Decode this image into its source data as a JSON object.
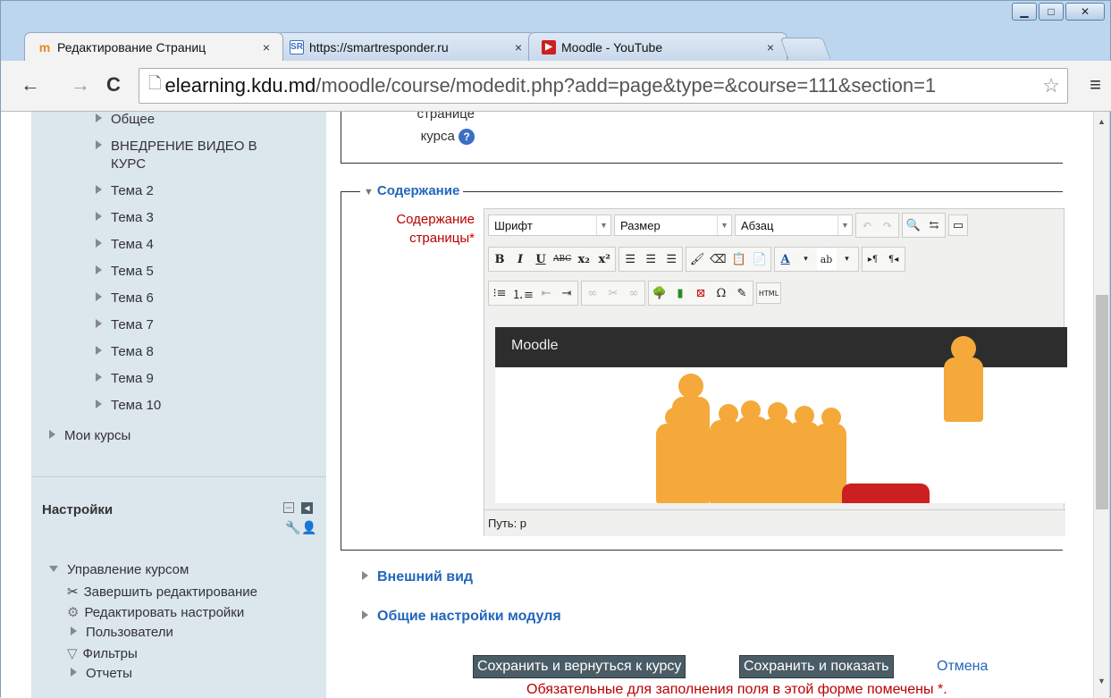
{
  "window": {
    "minimize_label": "▁",
    "maximize_label": "□",
    "close_label": "✕"
  },
  "tabs": [
    {
      "favicon": "moodle-favicon",
      "favicon_text": "m",
      "title": "Редактирование Страниц",
      "close": "×"
    },
    {
      "favicon": "sr-favicon",
      "favicon_text": "SR",
      "title": "https://smartresponder.ru",
      "close": "×"
    },
    {
      "favicon": "youtube-favicon",
      "favicon_text": "▶",
      "title": "Moodle - YouTube",
      "close": "×"
    }
  ],
  "toolbar": {
    "back": "←",
    "forward": "→",
    "reload": "C",
    "url_host": "elearning.kdu.md",
    "url_path": "/moodle/course/modedit.php?add=page&type=&course=111&section=1",
    "star": "☆",
    "menu": "≡"
  },
  "sidebar": {
    "items": [
      {
        "label": "Общее"
      },
      {
        "label": "ВНЕДРЕНИЕ ВИДЕО В"
      },
      {
        "label": "КУРС"
      },
      {
        "label": "Тема 2"
      },
      {
        "label": "Тема 3"
      },
      {
        "label": "Тема 4"
      },
      {
        "label": "Тема 5"
      },
      {
        "label": "Тема 6"
      },
      {
        "label": "Тема 7"
      },
      {
        "label": "Тема 8"
      },
      {
        "label": "Тема 9"
      },
      {
        "label": "Тема 10"
      }
    ],
    "my_courses": "Мои курсы",
    "settings_title": "Настройки",
    "course_admin": "Управление курсом",
    "admin_items": [
      {
        "label": "Завершить редактирование"
      },
      {
        "label": "Редактировать настройки"
      },
      {
        "label": "Пользователи"
      },
      {
        "label": "Фильтры"
      },
      {
        "label": "Отчеты"
      }
    ]
  },
  "main": {
    "top_label_line1": "странице",
    "top_label_line2": "курса",
    "help": "?",
    "content_legend": "Содержание",
    "content_label_line1": "Содержание",
    "content_label_line2": "страницы",
    "required_mark": "*",
    "appearance": "Внешний вид",
    "common_settings": "Общие настройки модуля",
    "save_return": "Сохранить и вернуться к курсу",
    "save_show": "Сохранить и показать",
    "cancel": "Отмена",
    "required_note": "Обязательные для заполнения поля в этой форме помечены"
  },
  "editor": {
    "font_select": "Шрифт",
    "size_select": "Размер",
    "format_select": "Абзац",
    "path": "Путь: p",
    "video_title": "Moodle",
    "html_button": "HTML",
    "bold": "B",
    "italic": "I",
    "underline": "U",
    "strike": "ABC",
    "sub": "x₂",
    "sup": "x²",
    "omega": "Ω"
  }
}
